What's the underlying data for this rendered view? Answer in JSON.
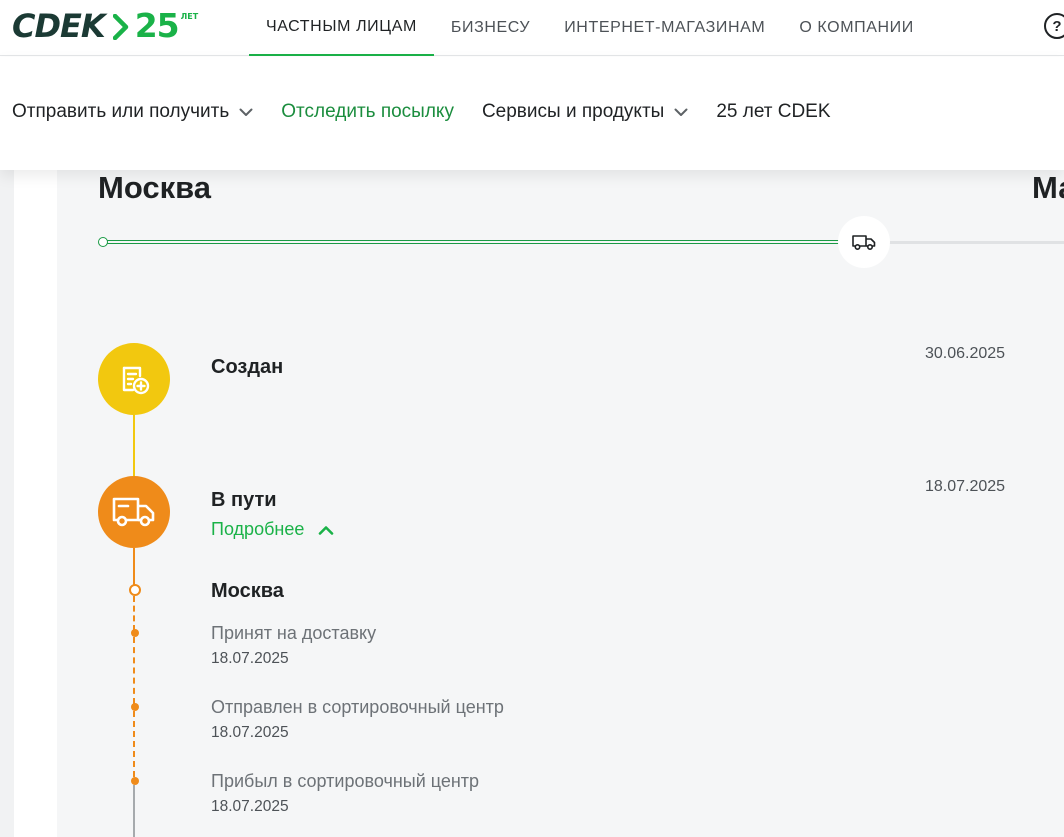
{
  "logo": {
    "brand": "CDEK",
    "years": "25",
    "years_suffix": "ЛЕТ"
  },
  "top_nav": {
    "items": [
      {
        "label": "ЧАСТНЫМ ЛИЦАМ",
        "active": true
      },
      {
        "label": "БИЗНЕСУ",
        "active": false
      },
      {
        "label": "ИНТЕРНЕТ-МАГАЗИНАМ",
        "active": false
      },
      {
        "label": "О КОМПАНИИ",
        "active": false
      }
    ],
    "help_icon": "question-circle-icon",
    "help_glyph": "?"
  },
  "sub_nav": {
    "items": [
      {
        "label": "Отправить или получить",
        "dropdown": true
      },
      {
        "label": "Отследить посылку",
        "dropdown": false
      },
      {
        "label": "Сервисы и продукты",
        "dropdown": true
      },
      {
        "label": "25 лет CDEK",
        "dropdown": false
      }
    ]
  },
  "route": {
    "from": "Москва",
    "to": "Ма",
    "progress": 0.79
  },
  "statuses": [
    {
      "title": "Создан",
      "date": "30.06.2025",
      "icon": "document-plus-icon",
      "color": "#f2c80f"
    },
    {
      "title": "В пути",
      "date": "18.07.2025",
      "icon": "truck-icon",
      "color": "#ef8b1a",
      "details_label": "Подробнее",
      "expanded": true
    }
  ],
  "in_transit_details": {
    "city": "Москва",
    "events": [
      {
        "title": "Принят на доставку",
        "date": "18.07.2025"
      },
      {
        "title": "Отправлен в сортировочный центр",
        "date": "18.07.2025"
      },
      {
        "title": "Прибыл в сортировочный центр",
        "date": "18.07.2025"
      }
    ]
  },
  "colors": {
    "brand_green": "#1ab248",
    "dark_green": "#1b3a34",
    "created_yellow": "#f2c80f",
    "transit_orange": "#ef8b1a"
  }
}
